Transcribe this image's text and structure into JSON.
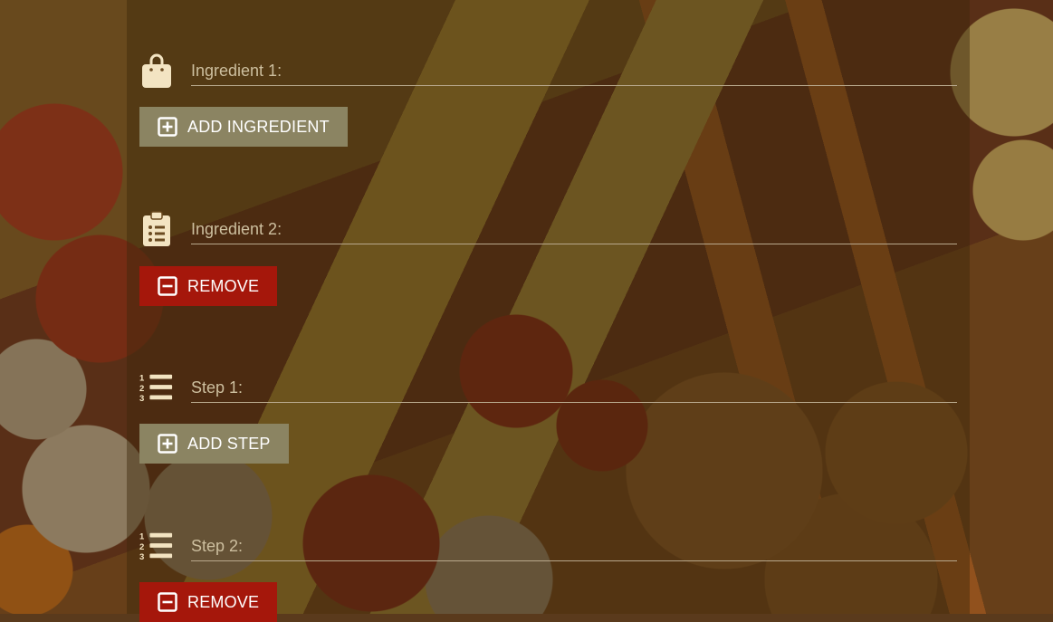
{
  "rows": [
    {
      "icon": "shopping-bag-icon",
      "placeholder": "Ingredient 1:",
      "button_label": "ADD INGREDIENT",
      "button_type": "add"
    },
    {
      "icon": "clipboard-list-icon",
      "placeholder": "Ingredient 2:",
      "button_label": "REMOVE",
      "button_type": "remove"
    },
    {
      "icon": "numbered-list-icon",
      "placeholder": "Step 1:",
      "button_label": "ADD STEP",
      "button_type": "add"
    },
    {
      "icon": "numbered-list-icon",
      "placeholder": "Step 2:",
      "button_label": "REMOVE",
      "button_type": "remove"
    }
  ],
  "colors": {
    "add_button": "#8b8462",
    "remove_button": "#a5170b",
    "icon": "#f3e4c2"
  }
}
